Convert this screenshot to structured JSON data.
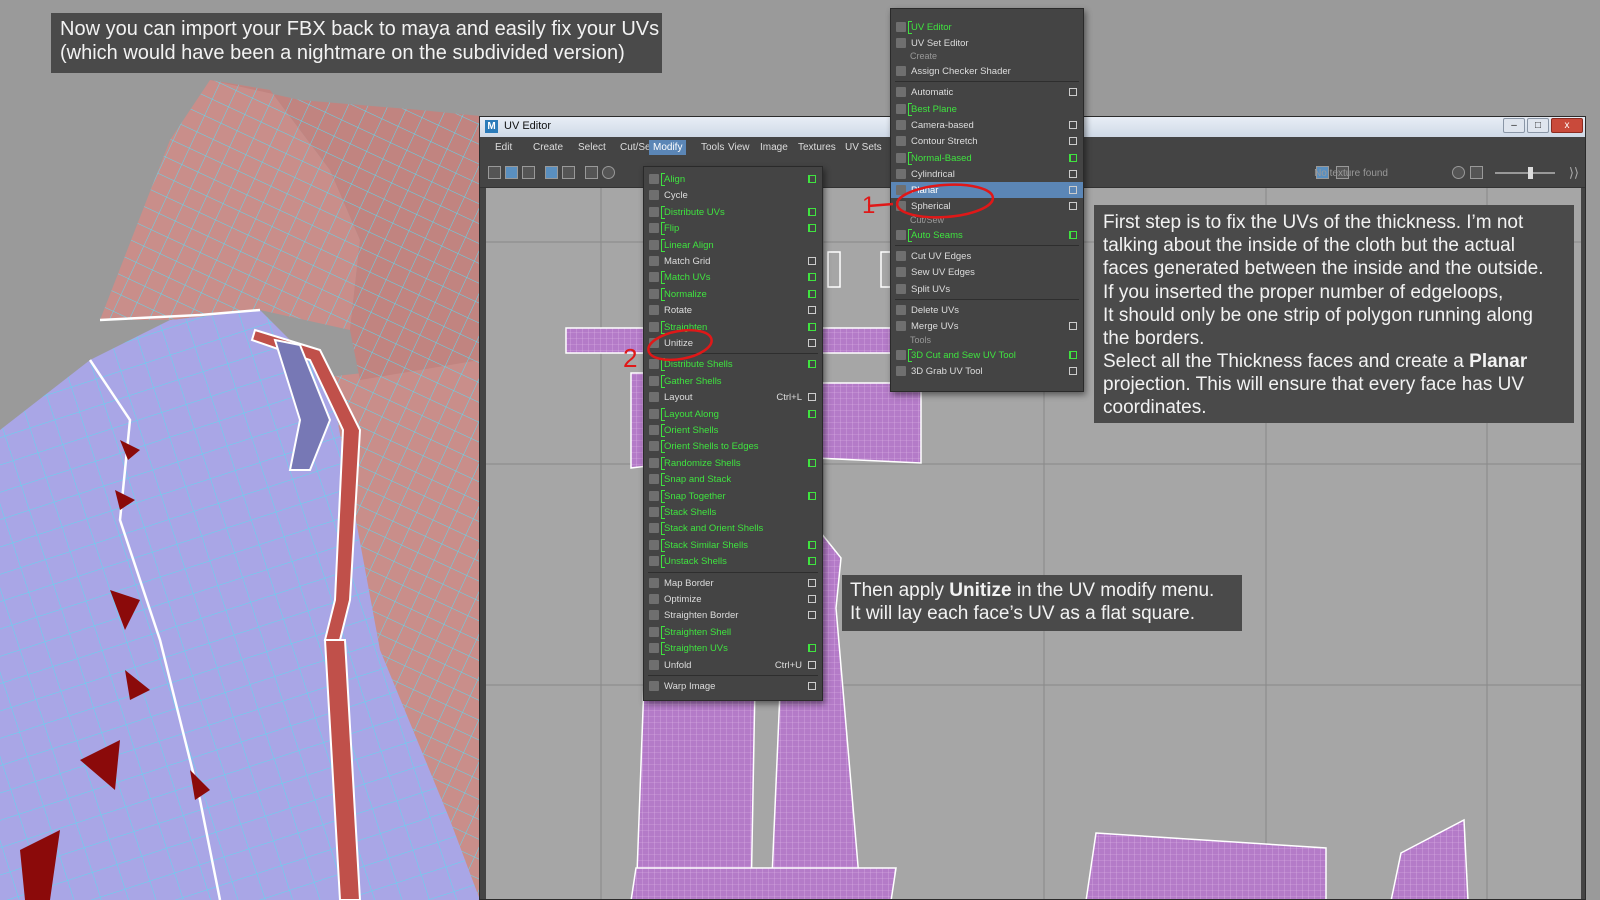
{
  "captions": {
    "top_line1": "Now you can import your FBX back to maya and easily fix your UVs",
    "top_line2": "(which would have been a nightmare on the subdivided version)",
    "right_lines": [
      "First step is to fix the UVs of the thickness. I’m not",
      "talking about the inside of the cloth but the actual",
      "faces generated between the inside and the outside.",
      "If you inserted the proper number of edgeloops,",
      "It should only be one strip of polygon running along",
      "the borders."
    ],
    "right_line7": "Select all the Thickness faces and create a",
    "right_bold": "Planar",
    "right_line8": "projection. This will ensure that every face has UV",
    "right_line9": "coordinates.",
    "mid_pre": "Then apply",
    "mid_bold": "Unitize",
    "mid_post": "in the UV modify menu.",
    "mid_line2": "It will lay each face’s UV as a flat square."
  },
  "annotations": {
    "step1": "1",
    "step2": "2"
  },
  "uv_editor": {
    "title": "UV Editor",
    "menubar": [
      "Edit",
      "Create",
      "Select",
      "Cut/Sew",
      "Modify",
      "Tools",
      "View",
      "Image",
      "Textures",
      "UV Sets"
    ],
    "active_menu": "Modify",
    "texture_status": "No texture found",
    "window_buttons": {
      "minimize": "–",
      "maximize": "□",
      "close": "x"
    }
  },
  "modify_menu": [
    {
      "label": "Align",
      "green": true,
      "opt": true
    },
    {
      "label": "Cycle",
      "green": false,
      "opt": false
    },
    {
      "label": "Distribute UVs",
      "green": true,
      "opt": true
    },
    {
      "label": "Flip",
      "green": true,
      "opt": true
    },
    {
      "label": "Linear Align",
      "green": true,
      "opt": false
    },
    {
      "label": "Match Grid",
      "green": false,
      "opt": true
    },
    {
      "label": "Match UVs",
      "green": true,
      "opt": true
    },
    {
      "label": "Normalize",
      "green": true,
      "opt": true
    },
    {
      "label": "Rotate",
      "green": false,
      "opt": true
    },
    {
      "label": "Straighten",
      "green": true,
      "opt": true
    },
    {
      "label": "Unitize",
      "green": false,
      "opt": true
    },
    {
      "sep": true
    },
    {
      "label": "Distribute Shells",
      "green": true,
      "opt": true
    },
    {
      "label": "Gather Shells",
      "green": true,
      "opt": false
    },
    {
      "label": "Layout",
      "green": false,
      "opt": true,
      "shortcut": "Ctrl+L"
    },
    {
      "label": "Layout Along",
      "green": true,
      "opt": true
    },
    {
      "label": "Orient Shells",
      "green": true,
      "opt": false
    },
    {
      "label": "Orient Shells to Edges",
      "green": true,
      "opt": false
    },
    {
      "label": "Randomize Shells",
      "green": true,
      "opt": true
    },
    {
      "label": "Snap and Stack",
      "green": true,
      "opt": false
    },
    {
      "label": "Snap Together",
      "green": true,
      "opt": true
    },
    {
      "label": "Stack Shells",
      "green": true,
      "opt": false
    },
    {
      "label": "Stack and Orient Shells",
      "green": true,
      "opt": false
    },
    {
      "label": "Stack Similar Shells",
      "green": true,
      "opt": true
    },
    {
      "label": "Unstack Shells",
      "green": true,
      "opt": true
    },
    {
      "sep": true
    },
    {
      "label": "Map Border",
      "green": false,
      "opt": true
    },
    {
      "label": "Optimize",
      "green": false,
      "opt": true
    },
    {
      "label": "Straighten Border",
      "green": false,
      "opt": true
    },
    {
      "label": "Straighten Shell",
      "green": true,
      "opt": false
    },
    {
      "label": "Straighten UVs",
      "green": true,
      "opt": true
    },
    {
      "label": "Unfold",
      "green": false,
      "opt": true,
      "shortcut": "Ctrl+U"
    },
    {
      "sep": true
    },
    {
      "label": "Warp Image",
      "green": false,
      "opt": true
    }
  ],
  "create_menu": {
    "top_items": [
      {
        "label": "UV Editor",
        "green": true
      },
      {
        "label": "UV Set Editor",
        "green": false
      }
    ],
    "section_create": "Create",
    "create_items": [
      {
        "label": "Assign Checker Shader",
        "green": false,
        "opt": false
      },
      {
        "sep": true
      },
      {
        "label": "Automatic",
        "green": false,
        "opt": true
      },
      {
        "label": "Best Plane",
        "green": true,
        "opt": false
      },
      {
        "label": "Camera-based",
        "green": false,
        "opt": true
      },
      {
        "label": "Contour Stretch",
        "green": false,
        "opt": true
      },
      {
        "label": "Normal-Based",
        "green": true,
        "opt": true
      },
      {
        "label": "Cylindrical",
        "green": false,
        "opt": true
      },
      {
        "label": "Planar",
        "green": false,
        "opt": true,
        "selected": true
      },
      {
        "label": "Spherical",
        "green": false,
        "opt": true
      }
    ],
    "section_cutsew": "Cut/Sew",
    "cutsew_items": [
      {
        "label": "Auto Seams",
        "green": true,
        "opt": true
      },
      {
        "sep": true
      },
      {
        "label": "Cut UV Edges",
        "green": false,
        "opt": false
      },
      {
        "label": "Sew UV Edges",
        "green": false,
        "opt": false
      },
      {
        "label": "Split UVs",
        "green": false,
        "opt": false
      },
      {
        "sep": true
      },
      {
        "label": "Delete UVs",
        "green": false,
        "opt": false
      },
      {
        "label": "Merge UVs",
        "green": false,
        "opt": true
      }
    ],
    "section_tools": "Tools",
    "tool_items": [
      {
        "label": "3D Cut and Sew UV Tool",
        "green": true,
        "opt": true
      },
      {
        "label": "3D Grab UV Tool",
        "green": false,
        "opt": true
      }
    ]
  },
  "colors": {
    "menu_green": "#3fe33f",
    "selection_blue": "#5b86b6",
    "uv_shell_fill": "#b47bc8",
    "mesh_lilac": "#a9a6e6",
    "mesh_salmon": "#c98e8a",
    "wire_cyan": "#5fd8ef",
    "annotation_red": "#e01818"
  }
}
